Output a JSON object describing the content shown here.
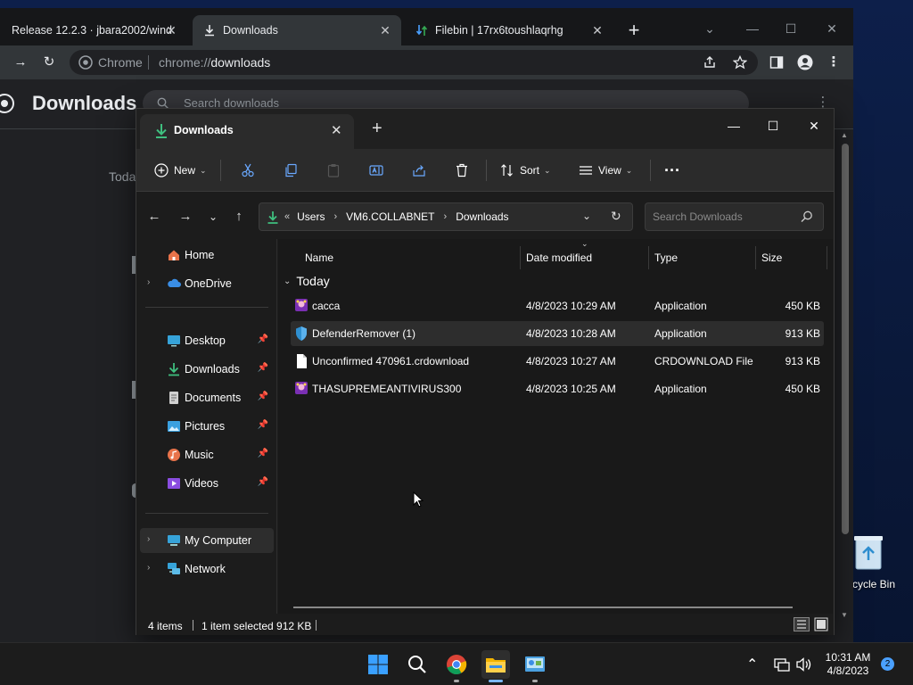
{
  "desktop": {
    "recycle_bin_label": "cycle Bin"
  },
  "chrome": {
    "tabs": [
      {
        "label": "Release 12.2.3 · jbara2002/windo"
      },
      {
        "label": "Downloads"
      },
      {
        "label": "Filebin | 17rx6toushlaqrhg"
      }
    ],
    "omnibox": {
      "site_label": "Chrome",
      "url_scheme": "chrome://",
      "url_path": "downloads"
    },
    "page": {
      "title": "Downloads",
      "search_placeholder": "Search downloads",
      "today_label": "Toda"
    }
  },
  "explorer": {
    "tab_label": "Downloads",
    "commands": {
      "new": "New",
      "sort": "Sort",
      "view": "View"
    },
    "breadcrumb": [
      "Users",
      "VM6.COLLABNET",
      "Downloads"
    ],
    "search_placeholder": "Search Downloads",
    "sidebar": {
      "items": [
        {
          "label": "Home",
          "icon": "home-icon"
        },
        {
          "label": "OneDrive",
          "icon": "cloud-icon"
        },
        {
          "label": "Desktop",
          "icon": "desktop-icon"
        },
        {
          "label": "Downloads",
          "icon": "download-icon"
        },
        {
          "label": "Documents",
          "icon": "document-icon"
        },
        {
          "label": "Pictures",
          "icon": "pictures-icon"
        },
        {
          "label": "Music",
          "icon": "music-icon"
        },
        {
          "label": "Videos",
          "icon": "video-icon"
        },
        {
          "label": "My Computer",
          "icon": "computer-icon"
        },
        {
          "label": "Network",
          "icon": "network-icon"
        }
      ]
    },
    "columns": {
      "name": "Name",
      "date": "Date modified",
      "type": "Type",
      "size": "Size"
    },
    "group_label": "Today",
    "files": [
      {
        "name": "cacca",
        "date": "4/8/2023 10:29 AM",
        "type": "Application",
        "size": "450 KB"
      },
      {
        "name": "DefenderRemover (1)",
        "date": "4/8/2023 10:28 AM",
        "type": "Application",
        "size": "913 KB"
      },
      {
        "name": "Unconfirmed 470961.crdownload",
        "date": "4/8/2023 10:27 AM",
        "type": "CRDOWNLOAD File",
        "size": "913 KB"
      },
      {
        "name": "THASUPREMEANTIVIRUS300",
        "date": "4/8/2023 10:25 AM",
        "type": "Application",
        "size": "450 KB"
      }
    ],
    "status": {
      "count": "4 items",
      "selection": "1 item selected  912 KB"
    }
  },
  "taskbar": {
    "time": "10:31 AM",
    "date": "4/8/2023",
    "notification_count": "2"
  },
  "colors": {
    "accent": "#4aa0ff",
    "explorer_bg": "#191919",
    "chrome_bg": "#202124"
  }
}
